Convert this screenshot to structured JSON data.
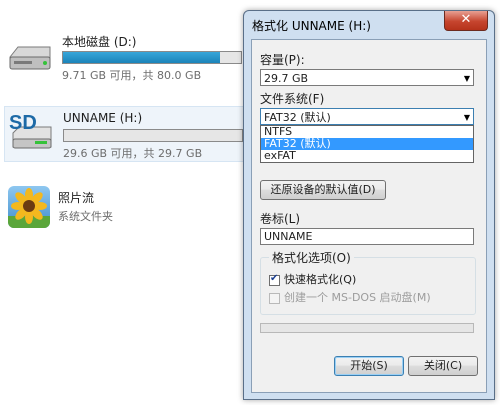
{
  "explorer": {
    "drives": [
      {
        "name": "本地磁盘 (D:)",
        "free_text": "9.71 GB 可用，共 80.0 GB",
        "used_fraction": 0.88,
        "icon": "hard-drive-icon"
      },
      {
        "name": "UNNAME (H:)",
        "free_text": "29.6 GB 可用，共 29.7 GB",
        "used_fraction": 0.0,
        "icon": "sd-card-icon",
        "icon_text": "SD"
      }
    ],
    "photo_stream": {
      "title": "照片流",
      "subtitle": "系统文件夹",
      "icon": "photo-stream-icon"
    }
  },
  "dialog": {
    "title": "格式化 UNNAME (H:)",
    "capacity_label": "容量(P):",
    "capacity_value": "29.7 GB",
    "filesystem_label": "文件系统(F)",
    "filesystem_value": "FAT32 (默认)",
    "filesystem_options": [
      "NTFS",
      "FAT32 (默认)",
      "exFAT"
    ],
    "restore_button": "还原设备的默认值(D)",
    "volume_label": "卷标(L)",
    "volume_value": "UNNAME",
    "format_options_title": "格式化选项(O)",
    "quick_format": {
      "label": "快速格式化(Q)",
      "checked": true
    },
    "msdos_boot": {
      "label": "创建一个 MS-DOS 启动盘(M)",
      "checked": false
    },
    "progress": 0.0,
    "start_button": "开始(S)",
    "close_button": "关闭(C)",
    "close_glyph": "✕"
  },
  "colors": {
    "selection": "#3399ff",
    "drive_bar": "#26a0da",
    "dialog_frame": "#cfdff0"
  }
}
